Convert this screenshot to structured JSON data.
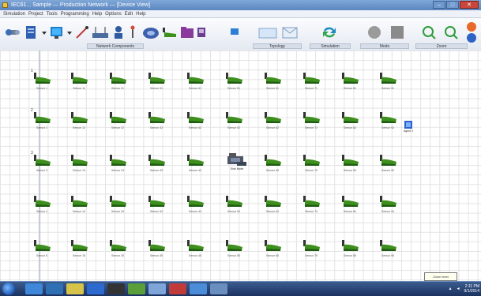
{
  "window": {
    "title": "IEC61... Sample — Production Network — [Device View]",
    "minimize": "–",
    "maximize": "□",
    "close": "✕"
  },
  "menu": [
    "Simulation",
    "Project",
    "Tools",
    "Programming",
    "Help",
    "Options",
    "Edit",
    "Help"
  ],
  "toolbar": {
    "groups": {
      "network_components": "Network Components",
      "topology": "Topology",
      "simulation": "Simulation",
      "mode": "Mode",
      "zoom": "Zoom"
    }
  },
  "canvas": {
    "rows": [
      {
        "marker": "1",
        "nodes": [
          "Sensor 1",
          "Sensor 11",
          "Sensor 21",
          "Sensor 31",
          "Sensor 41",
          "Sensor 51",
          "Sensor 61",
          "Sensor 71",
          "Sensor 81",
          "Sensor 91"
        ]
      },
      {
        "marker": "2",
        "nodes": [
          "Sensor 2",
          "Sensor 12",
          "Sensor 22",
          "Sensor 32",
          "Sensor 42",
          "Sensor 52",
          "Sensor 62",
          "Sensor 72",
          "Sensor 82",
          "Sensor 92"
        ]
      },
      {
        "marker": "3",
        "nodes": [
          "Sensor 3",
          "Sensor 13",
          "Sensor 23",
          "Sensor 33",
          "Sensor 43",
          "",
          "Sensor 63",
          "Sensor 73",
          "Sensor 83",
          "Sensor 93"
        ]
      },
      {
        "marker": "",
        "nodes": [
          "Sensor 4",
          "Sensor 14",
          "Sensor 24",
          "Sensor 34",
          "Sensor 44",
          "Sensor 54",
          "Sensor 64",
          "Sensor 74",
          "Sensor 84",
          "Sensor 94"
        ]
      },
      {
        "marker": "",
        "nodes": [
          "Sensor 5",
          "Sensor 15",
          "Sensor 25",
          "Sensor 35",
          "Sensor 45",
          "Sensor 55",
          "Sensor 65",
          "Sensor 75",
          "Sensor 85",
          "Sensor 95"
        ]
      },
      {
        "marker": "",
        "nodes": [
          "Sensor 6",
          "Sensor 16",
          "Sensor 26",
          "Sensor 36",
          "Sensor 46",
          "Sensor 56",
          "Sensor 66",
          "Sensor 76",
          "Sensor 86",
          "Sensor 96"
        ]
      }
    ],
    "sink_label": "Sink Node",
    "agent_label": "Agent 1",
    "tooltip": "Zoom level"
  },
  "taskbar": {
    "time": "2:11 PM",
    "date": "9/1/2014"
  },
  "colors": {
    "sensor_green": "#3f8f1f",
    "sensor_dark": "#1f5e12",
    "title_blue": "#5b86c0"
  }
}
